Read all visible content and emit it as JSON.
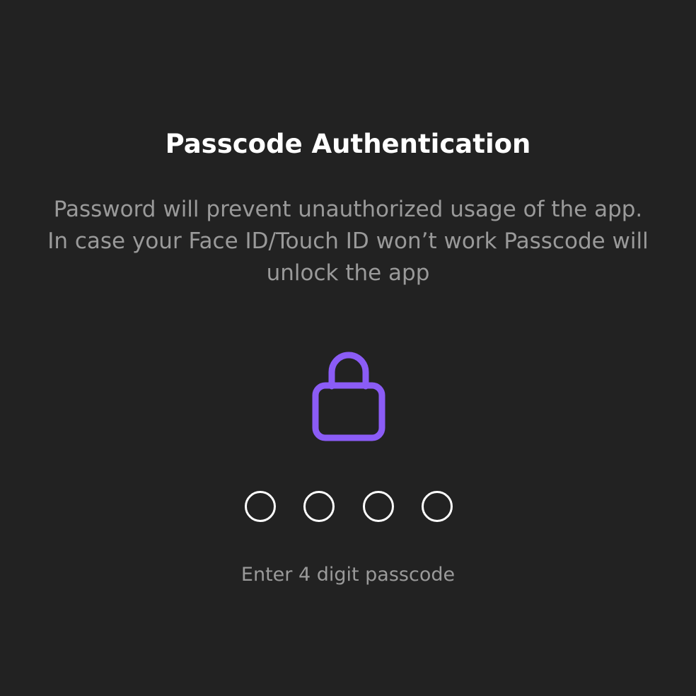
{
  "screen": {
    "title": "Passcode Authentication",
    "description": "Password will prevent unauthorized usage of the app. In case your Face ID/Touch ID won’t work Passcode will unlock the app",
    "lock_icon": "lock-icon",
    "passcode_length": 4,
    "digits_entered": 0,
    "hint": "Enter 4 digit passcode"
  },
  "colors": {
    "background": "#222222",
    "title": "#ffffff",
    "secondary_text": "#9a9a9a",
    "accent": "#8b5cf6",
    "dot_outline": "#ffffff"
  }
}
